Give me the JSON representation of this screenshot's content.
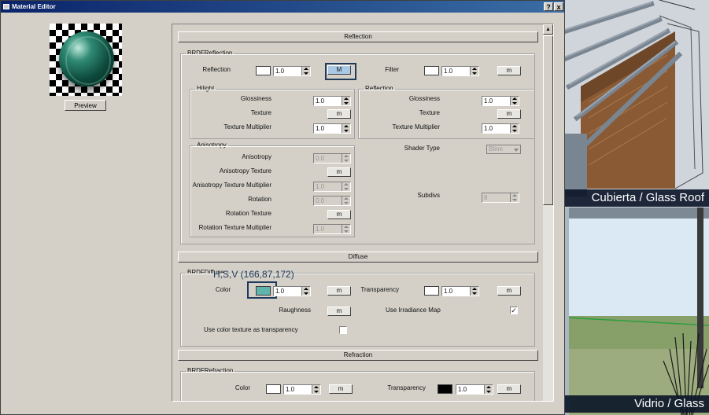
{
  "window": {
    "title": "Material Editor",
    "help": "?",
    "close": "x"
  },
  "preview_button": "Preview",
  "rollouts": {
    "reflection": "Reflection",
    "diffuse": "Diffuse",
    "refraction": "Refraction"
  },
  "brdf_reflection": {
    "group_label": "BRDFReflection",
    "reflection_label": "Reflection",
    "reflection_value": "1.0",
    "reflection_color": "#ffffff",
    "reflection_map": "M",
    "filter_label": "Filter",
    "filter_value": "1.0",
    "filter_color": "#ffffff",
    "filter_map": "m",
    "hilight": {
      "group_label": "Hilight",
      "glossiness_label": "Glossiness",
      "glossiness_value": "1.0",
      "texture_label": "Texture",
      "texture_map": "m",
      "texture_multiplier_label": "Texture Multiplier",
      "texture_multiplier_value": "1.0"
    },
    "reflection_sub": {
      "group_label": "Reflection",
      "glossiness_label": "Glossiness",
      "glossiness_value": "1.0",
      "texture_label": "Texture",
      "texture_map": "m",
      "texture_multiplier_label": "Texture Multiplier",
      "texture_multiplier_value": "1.0"
    },
    "anisotropy": {
      "group_label": "Anisotropy",
      "anisotropy_label": "Anisotropy",
      "anisotropy_value": "0.0",
      "anisotropy_texture_label": "Anisotropy Texture",
      "anisotropy_texture_map": "m",
      "anisotropy_texture_multiplier_label": "Anisotropy Texture Multiplier",
      "anisotropy_texture_multiplier_value": "1.0",
      "rotation_label": "Rotation",
      "rotation_value": "0.0",
      "rotation_texture_label": "Rotation Texture",
      "rotation_texture_map": "m",
      "rotation_texture_multiplier_label": "Rotation Texture Multiplier",
      "rotation_texture_multiplier_value": "1.0"
    },
    "shader_type_label": "Shader Type",
    "shader_type_value": "Blinn",
    "subdivs_label": "Subdivs",
    "subdivs_value": "8"
  },
  "brdf_diffuse": {
    "group_label": "BRDFDiffuse",
    "hsv_tooltip": "H,S,V (166,87,172)",
    "color_label": "Color",
    "color_value": "1.0",
    "color_swatch": "#5fb5ad",
    "color_map": "m",
    "transparency_label": "Transparency",
    "transparency_value": "1.0",
    "transparency_color": "#ffffff",
    "transparency_map": "m",
    "roughness_label": "Raughness",
    "roughness_map": "m",
    "irradiance_label": "Use Irradiance Map",
    "irradiance_checked": "✓",
    "color_texture_label": "Use color texture as transparency",
    "color_texture_checked": ""
  },
  "brdf_refraction": {
    "group_label": "BRDFRefraction",
    "color_label": "Color",
    "color_value": "1.0",
    "color_swatch": "#ffffff",
    "color_map": "m",
    "transparency_label": "Transparency",
    "transparency_value": "1.0",
    "transparency_color": "#000000",
    "transparency_map": "m"
  },
  "side_images": {
    "top_caption": "Cubierta / Glass Roof",
    "bottom_caption": "Vidrio / Glass"
  }
}
